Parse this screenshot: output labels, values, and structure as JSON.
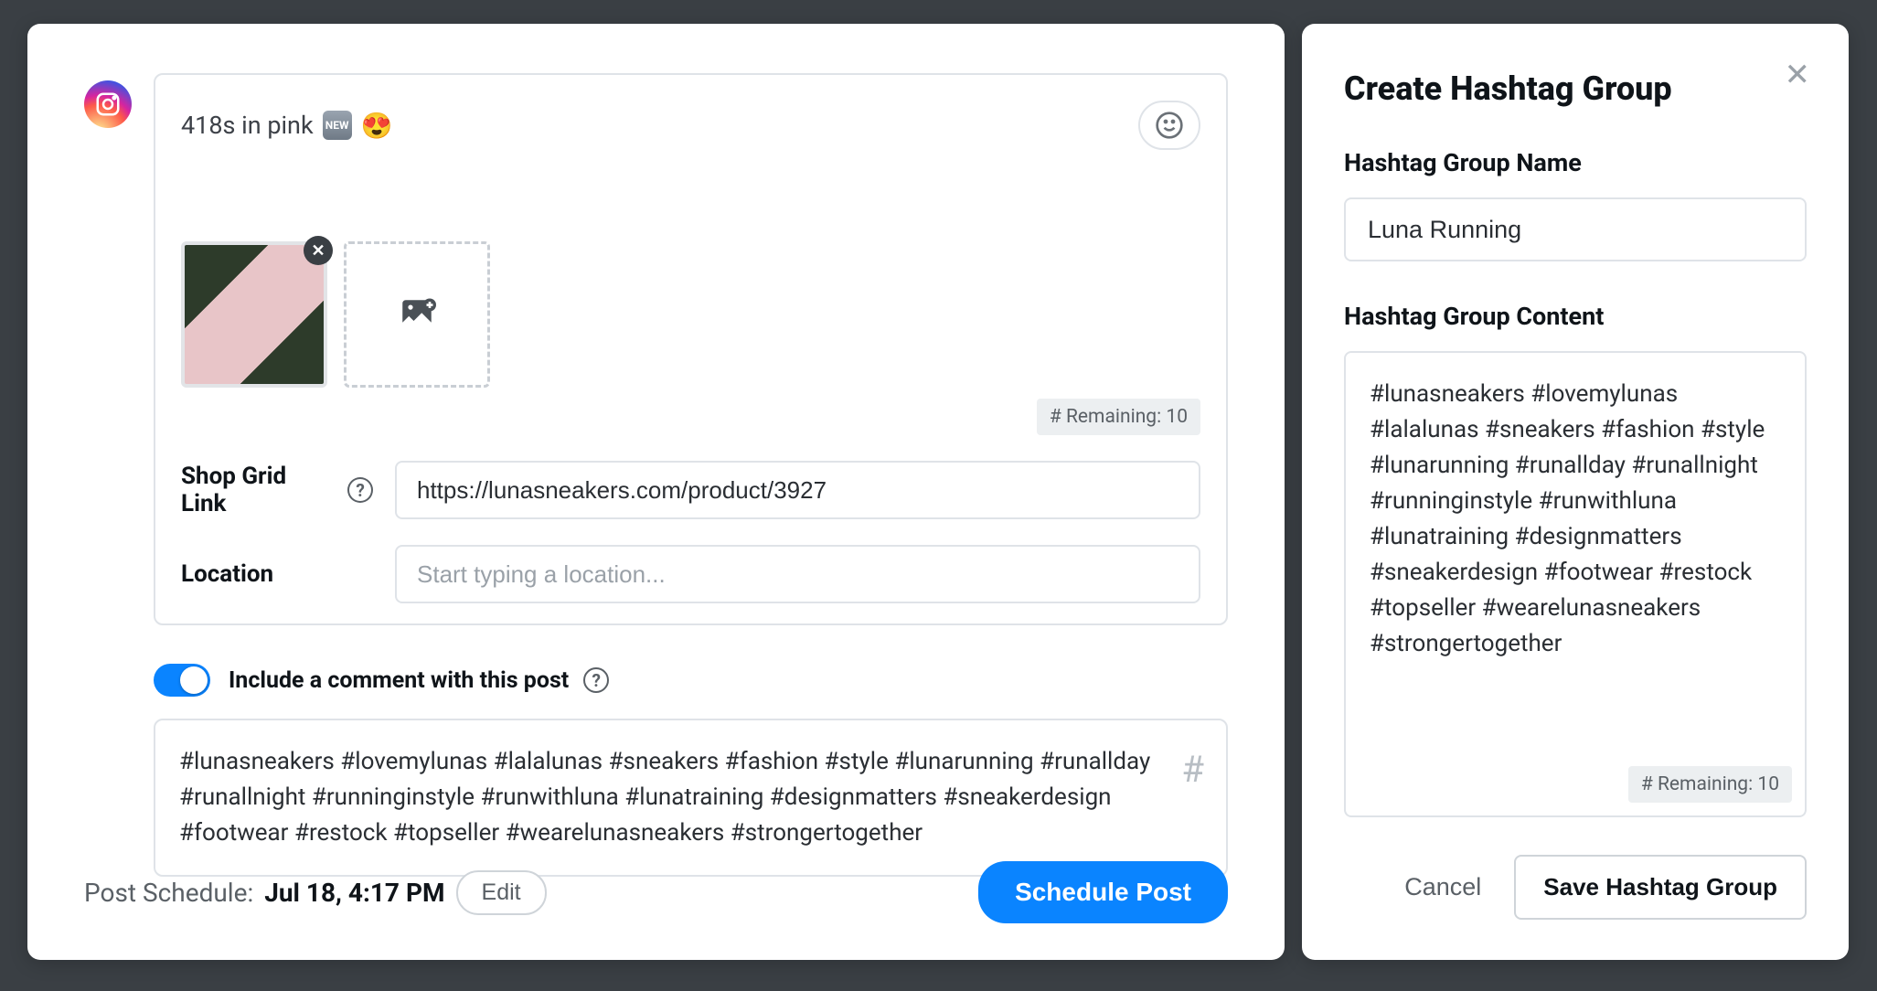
{
  "compose": {
    "caption_text": "418s in pink",
    "caption_badge": "NEW",
    "caption_emoji": "😍",
    "remaining_label": "# Remaining: 10",
    "shop_label": "Shop Grid Link",
    "shop_url": "https://lunasneakers.com/product/3927",
    "location_label": "Location",
    "location_placeholder": "Start typing a location...",
    "toggle_label": "Include a comment with this post",
    "comment_text": "#lunasneakers #lovemylunas #lalalunas #sneakers #fashion #style #lunarunning #runallday #runallnight #runninginstyle #runwithluna #lunatraining #designmatters #sneakerdesign #footwear #restock #topseller #wearelunasneakers #strongertogether",
    "schedule_prefix": "Post Schedule:",
    "schedule_date": "Jul 18, 4:17 PM",
    "edit_label": "Edit",
    "schedule_button": "Schedule Post"
  },
  "panel": {
    "title": "Create Hashtag Group",
    "name_label": "Hashtag Group Name",
    "name_value": "Luna Running",
    "content_label": "Hashtag Group Content",
    "content_value": "#lunasneakers #lovemylunas #lalalunas #sneakers #fashion #style #lunarunning #runallday #runallnight #runninginstyle #runwithluna #lunatraining #designmatters #sneakerdesign #footwear #restock #topseller #wearelunasneakers #strongertogether",
    "remaining_label": "# Remaining: 10",
    "cancel_label": "Cancel",
    "save_label": "Save Hashtag Group"
  }
}
